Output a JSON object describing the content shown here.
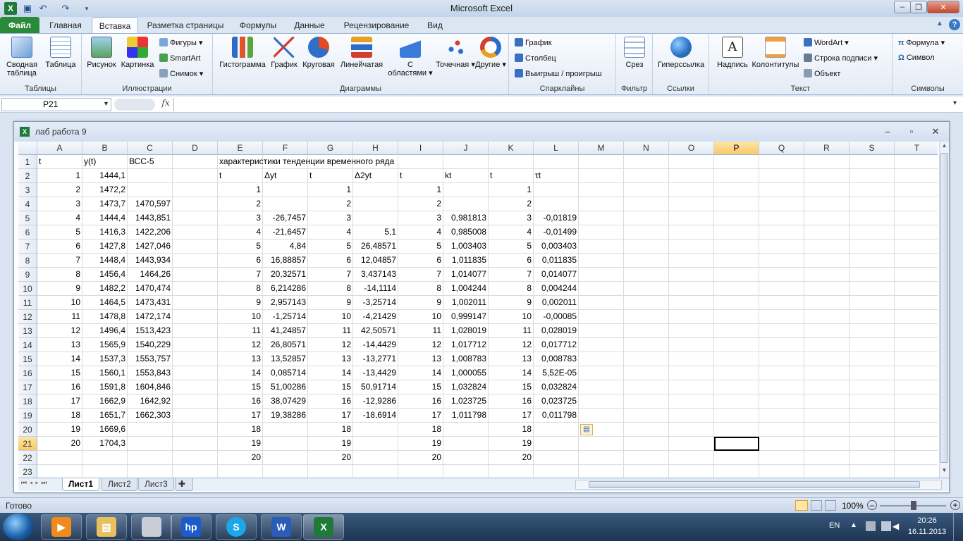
{
  "app": {
    "title": "Microsoft Excel"
  },
  "tabs": [
    "Файл",
    "Главная",
    "Вставка",
    "Разметка страницы",
    "Формулы",
    "Данные",
    "Рецензирование",
    "Вид"
  ],
  "active_tab": "Вставка",
  "ribbon": {
    "tables": {
      "label": "Таблицы",
      "pivot": "Сводная таблица",
      "table": "Таблица"
    },
    "illustrations": {
      "label": "Иллюстрации",
      "picture": "Рисунок",
      "clipart": "Картинка",
      "shapes": "Фигуры",
      "smartart": "SmartArt",
      "screenshot": "Снимок"
    },
    "charts": {
      "label": "Диаграммы",
      "column": "Гистограмма",
      "line": "График",
      "pie": "Круговая",
      "bar": "Линейчатая",
      "area": "С областями",
      "scatter": "Точечная",
      "other": "Другие"
    },
    "sparklines": {
      "label": "Спарклайны",
      "line": "График",
      "column": "Столбец",
      "winloss": "Выигрыш / проигрыш"
    },
    "filter": {
      "label": "Фильтр",
      "slicer": "Срез"
    },
    "links": {
      "label": "Ссылки",
      "hyperlink": "Гиперссылка"
    },
    "text": {
      "label": "Текст",
      "textbox": "Надпись",
      "headerfooter": "Колонтитулы",
      "wordart": "WordArt",
      "sigline": "Строка подписи",
      "object": "Объект"
    },
    "symbols": {
      "label": "Символы",
      "equation": "Формула",
      "symbol": "Символ"
    }
  },
  "formula_bar": {
    "name_box": "P21",
    "fx": "fx",
    "value": ""
  },
  "workbook": {
    "title": "лаб работа 9"
  },
  "columns": [
    "A",
    "B",
    "C",
    "D",
    "E",
    "F",
    "G",
    "H",
    "I",
    "J",
    "K",
    "L",
    "M",
    "N",
    "O",
    "P",
    "Q",
    "R",
    "S",
    "T"
  ],
  "selected_column": "P",
  "selected_row": "21",
  "rows": [
    {
      "n": "1",
      "c": {
        "A": "t",
        "B": "y(t)",
        "C": "ВСС-5",
        "E": "характеристики тенденции временного ряда"
      }
    },
    {
      "n": "2",
      "c": {
        "A": "1",
        "B": "1444,1",
        "E": "t",
        "F": "Δyt",
        "G": "t",
        "H": "Δ2yt",
        "I": "t",
        "J": "kt",
        "K": "t",
        "L": "τt"
      }
    },
    {
      "n": "3",
      "c": {
        "A": "2",
        "B": "1472,2",
        "E": "1",
        "G": "1",
        "I": "1",
        "K": "1"
      }
    },
    {
      "n": "4",
      "c": {
        "A": "3",
        "B": "1473,7",
        "C": "1470,597",
        "E": "2",
        "G": "2",
        "I": "2",
        "K": "2"
      }
    },
    {
      "n": "5",
      "c": {
        "A": "4",
        "B": "1444,4",
        "C": "1443,851",
        "E": "3",
        "F": "-26,7457",
        "G": "3",
        "I": "3",
        "J": "0,981813",
        "K": "3",
        "L": "-0,01819"
      }
    },
    {
      "n": "6",
      "c": {
        "A": "5",
        "B": "1416,3",
        "C": "1422,206",
        "E": "4",
        "F": "-21,6457",
        "G": "4",
        "H": "5,1",
        "I": "4",
        "J": "0,985008",
        "K": "4",
        "L": "-0,01499"
      }
    },
    {
      "n": "7",
      "c": {
        "A": "6",
        "B": "1427,8",
        "C": "1427,046",
        "E": "5",
        "F": "4,84",
        "G": "5",
        "H": "26,48571",
        "I": "5",
        "J": "1,003403",
        "K": "5",
        "L": "0,003403"
      }
    },
    {
      "n": "8",
      "c": {
        "A": "7",
        "B": "1448,4",
        "C": "1443,934",
        "E": "6",
        "F": "16,88857",
        "G": "6",
        "H": "12,04857",
        "I": "6",
        "J": "1,011835",
        "K": "6",
        "L": "0,011835"
      }
    },
    {
      "n": "9",
      "c": {
        "A": "8",
        "B": "1456,4",
        "C": "1464,26",
        "E": "7",
        "F": "20,32571",
        "G": "7",
        "H": "3,437143",
        "I": "7",
        "J": "1,014077",
        "K": "7",
        "L": "0,014077"
      }
    },
    {
      "n": "10",
      "c": {
        "A": "9",
        "B": "1482,2",
        "C": "1470,474",
        "E": "8",
        "F": "6,214286",
        "G": "8",
        "H": "-14,1114",
        "I": "8",
        "J": "1,004244",
        "K": "8",
        "L": "0,004244"
      }
    },
    {
      "n": "11",
      "c": {
        "A": "10",
        "B": "1464,5",
        "C": "1473,431",
        "E": "9",
        "F": "2,957143",
        "G": "9",
        "H": "-3,25714",
        "I": "9",
        "J": "1,002011",
        "K": "9",
        "L": "0,002011"
      }
    },
    {
      "n": "12",
      "c": {
        "A": "11",
        "B": "1478,8",
        "C": "1472,174",
        "E": "10",
        "F": "-1,25714",
        "G": "10",
        "H": "-4,21429",
        "I": "10",
        "J": "0,999147",
        "K": "10",
        "L": "-0,00085"
      }
    },
    {
      "n": "13",
      "c": {
        "A": "12",
        "B": "1496,4",
        "C": "1513,423",
        "E": "11",
        "F": "41,24857",
        "G": "11",
        "H": "42,50571",
        "I": "11",
        "J": "1,028019",
        "K": "11",
        "L": "0,028019"
      }
    },
    {
      "n": "14",
      "c": {
        "A": "13",
        "B": "1565,9",
        "C": "1540,229",
        "E": "12",
        "F": "26,80571",
        "G": "12",
        "H": "-14,4429",
        "I": "12",
        "J": "1,017712",
        "K": "12",
        "L": "0,017712"
      }
    },
    {
      "n": "15",
      "c": {
        "A": "14",
        "B": "1537,3",
        "C": "1553,757",
        "E": "13",
        "F": "13,52857",
        "G": "13",
        "H": "-13,2771",
        "I": "13",
        "J": "1,008783",
        "K": "13",
        "L": "0,008783"
      }
    },
    {
      "n": "16",
      "c": {
        "A": "15",
        "B": "1560,1",
        "C": "1553,843",
        "E": "14",
        "F": "0,085714",
        "G": "14",
        "H": "-13,4429",
        "I": "14",
        "J": "1,000055",
        "K": "14",
        "L": "5,52E-05"
      }
    },
    {
      "n": "17",
      "c": {
        "A": "16",
        "B": "1591,8",
        "C": "1604,846",
        "E": "15",
        "F": "51,00286",
        "G": "15",
        "H": "50,91714",
        "I": "15",
        "J": "1,032824",
        "K": "15",
        "L": "0,032824"
      }
    },
    {
      "n": "18",
      "c": {
        "A": "17",
        "B": "1662,9",
        "C": "1642,92",
        "E": "16",
        "F": "38,07429",
        "G": "16",
        "H": "-12,9286",
        "I": "16",
        "J": "1,023725",
        "K": "16",
        "L": "0,023725"
      }
    },
    {
      "n": "19",
      "c": {
        "A": "18",
        "B": "1651,7",
        "C": "1662,303",
        "E": "17",
        "F": "19,38286",
        "G": "17",
        "H": "-18,6914",
        "I": "17",
        "J": "1,011798",
        "K": "17",
        "L": "0,011798"
      }
    },
    {
      "n": "20",
      "c": {
        "A": "19",
        "B": "1669,6",
        "E": "18",
        "G": "18",
        "I": "18",
        "K": "18"
      }
    },
    {
      "n": "21",
      "c": {
        "A": "20",
        "B": "1704,3",
        "E": "19",
        "G": "19",
        "I": "19",
        "K": "19"
      }
    },
    {
      "n": "22",
      "c": {
        "E": "20",
        "G": "20",
        "I": "20",
        "K": "20"
      }
    },
    {
      "n": "23",
      "c": {}
    }
  ],
  "text_columns": [
    "A1",
    "B1",
    "C1",
    "E1",
    "E2",
    "F2",
    "G2",
    "H2",
    "I2",
    "J2",
    "K2",
    "L2"
  ],
  "sheets": [
    "Лист1",
    "Лист2",
    "Лист3"
  ],
  "active_sheet": "Лист1",
  "status": {
    "ready": "Готово",
    "zoom": "100%"
  },
  "taskbar": {
    "lang": "EN",
    "time": "20:26",
    "date": "16.11.2013"
  }
}
